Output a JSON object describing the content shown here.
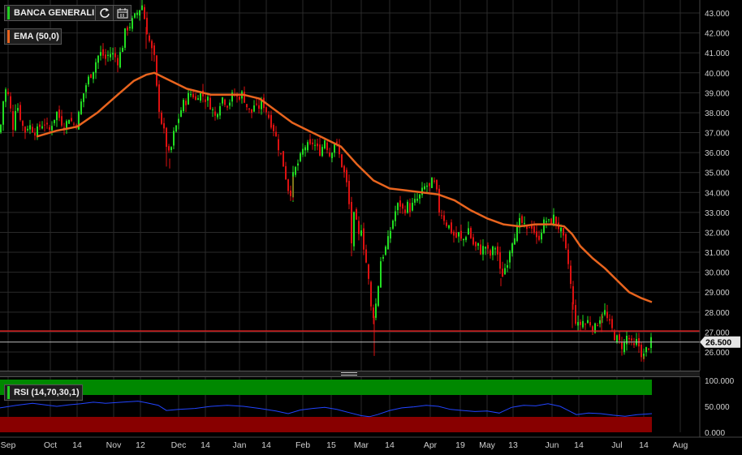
{
  "main_legend": {
    "symbol": "BANCA GENERALI",
    "symbol_color": "#22cc22",
    "refresh_icon": "refresh-icon",
    "calendar_icon": "calendar-icon"
  },
  "ema_legend": {
    "label": "EMA (50,0)",
    "color": "#e8641e"
  },
  "rsi_legend": {
    "label": "RSI (14,70,30,1)",
    "color": "#22cc22"
  },
  "colors": {
    "up": "#22dd22",
    "down": "#dd1111",
    "ema": "#e8641e",
    "support_line": "#dd2222",
    "rsi_line": "#2244ff",
    "rsi_overbought": "#008800",
    "rsi_oversold": "#880000",
    "grid": "#2a2a2a"
  },
  "chart_data": [
    {
      "type": "candlestick",
      "title": "BANCA GENERALI",
      "y_ticks": [
        "43.000",
        "42.000",
        "41.000",
        "40.000",
        "39.000",
        "38.000",
        "37.000",
        "36.000",
        "35.000",
        "34.000",
        "33.000",
        "32.000",
        "31.000",
        "30.000",
        "29.000",
        "28.000",
        "27.000",
        "26.000"
      ],
      "ylim": [
        25.4,
        43.5
      ],
      "x_ticks": [
        "Sep",
        "Oct",
        "14",
        "Nov",
        "12",
        "Dec",
        "14",
        "Jan",
        "14",
        "Feb",
        "15",
        "Mar",
        "14",
        "Apr",
        "19",
        "May",
        "13",
        "Jun",
        "14",
        "Jul",
        "14",
        "Aug"
      ],
      "last_price_label": "26.500",
      "last_price": 26.5,
      "support_level": 27.05,
      "close_path": [
        [
          0,
          37.0
        ],
        [
          4,
          38.6
        ],
        [
          8,
          39.3
        ],
        [
          12,
          38.4
        ],
        [
          16,
          37.3
        ],
        [
          20,
          38.6
        ],
        [
          25,
          37.8
        ],
        [
          30,
          37.0
        ],
        [
          35,
          37.4
        ],
        [
          40,
          37.2
        ],
        [
          45,
          37.0
        ],
        [
          50,
          37.4
        ],
        [
          55,
          37.5
        ],
        [
          60,
          37.0
        ],
        [
          65,
          37.6
        ],
        [
          70,
          38.0
        ],
        [
          75,
          37.6
        ],
        [
          80,
          37.3
        ],
        [
          85,
          37.8
        ],
        [
          90,
          37.4
        ],
        [
          95,
          37.5
        ],
        [
          100,
          38.5
        ],
        [
          105,
          39.3
        ],
        [
          110,
          39.8
        ],
        [
          115,
          40.2
        ],
        [
          120,
          40.8
        ],
        [
          125,
          41.0
        ],
        [
          130,
          40.7
        ],
        [
          135,
          41.0
        ],
        [
          140,
          40.9
        ],
        [
          145,
          40.6
        ],
        [
          150,
          41.2
        ],
        [
          155,
          42.2
        ],
        [
          160,
          42.4
        ],
        [
          165,
          42.7
        ],
        [
          170,
          43.1
        ],
        [
          175,
          43.4
        ],
        [
          180,
          42.3
        ],
        [
          185,
          41.4
        ],
        [
          190,
          40.7
        ],
        [
          193,
          39.2
        ],
        [
          197,
          37.9
        ],
        [
          201,
          37.2
        ],
        [
          205,
          36.4
        ],
        [
          209,
          35.7
        ],
        [
          213,
          36.8
        ],
        [
          217,
          37.3
        ],
        [
          221,
          37.9
        ],
        [
          225,
          38.4
        ],
        [
          229,
          38.6
        ],
        [
          233,
          38.9
        ],
        [
          237,
          39.0
        ],
        [
          241,
          38.6
        ],
        [
          245,
          39.1
        ],
        [
          249,
          38.9
        ],
        [
          253,
          38.7
        ],
        [
          257,
          38.6
        ],
        [
          261,
          38.2
        ],
        [
          265,
          37.8
        ],
        [
          269,
          38.3
        ],
        [
          273,
          38.8
        ],
        [
          277,
          38.6
        ],
        [
          281,
          38.4
        ],
        [
          285,
          38.8
        ],
        [
          289,
          38.9
        ],
        [
          293,
          38.7
        ],
        [
          297,
          39.0
        ],
        [
          301,
          38.7
        ],
        [
          305,
          38.2
        ],
        [
          309,
          37.9
        ],
        [
          313,
          38.4
        ],
        [
          317,
          38.1
        ],
        [
          321,
          38.5
        ],
        [
          325,
          38.4
        ],
        [
          329,
          38.0
        ],
        [
          333,
          37.6
        ],
        [
          337,
          37.2
        ],
        [
          341,
          36.6
        ],
        [
          345,
          36.0
        ],
        [
          349,
          35.4
        ],
        [
          353,
          34.6
        ],
        [
          357,
          33.8
        ],
        [
          361,
          34.8
        ],
        [
          365,
          35.3
        ],
        [
          369,
          35.6
        ],
        [
          373,
          36.1
        ],
        [
          377,
          36.4
        ],
        [
          381,
          36.2
        ],
        [
          385,
          36.5
        ],
        [
          389,
          36.3
        ],
        [
          393,
          36.0
        ],
        [
          397,
          36.3
        ],
        [
          401,
          36.8
        ],
        [
          405,
          35.8
        ],
        [
          409,
          36.2
        ],
        [
          413,
          36.6
        ],
        [
          417,
          36.0
        ],
        [
          421,
          35.4
        ],
        [
          425,
          34.8
        ],
        [
          429,
          34.0
        ],
        [
          433,
          31.5
        ],
        [
          437,
          33.2
        ],
        [
          441,
          31.6
        ],
        [
          445,
          32.3
        ],
        [
          449,
          31.0
        ],
        [
          453,
          30.0
        ],
        [
          457,
          28.2
        ],
        [
          461,
          27.8
        ],
        [
          465,
          29.0
        ],
        [
          469,
          30.6
        ],
        [
          473,
          31.0
        ],
        [
          477,
          31.4
        ],
        [
          481,
          32.1
        ],
        [
          485,
          32.8
        ],
        [
          489,
          33.3
        ],
        [
          493,
          33.4
        ],
        [
          497,
          33.0
        ],
        [
          501,
          33.4
        ],
        [
          505,
          33.2
        ],
        [
          509,
          33.4
        ],
        [
          513,
          33.6
        ],
        [
          517,
          33.8
        ],
        [
          521,
          34.1
        ],
        [
          525,
          34.4
        ],
        [
          529,
          34.2
        ],
        [
          533,
          34.6
        ],
        [
          537,
          34.2
        ],
        [
          541,
          33.1
        ],
        [
          545,
          32.9
        ],
        [
          549,
          32.5
        ],
        [
          553,
          32.3
        ],
        [
          557,
          32.0
        ],
        [
          561,
          31.7
        ],
        [
          565,
          31.9
        ],
        [
          569,
          31.5
        ],
        [
          573,
          31.8
        ],
        [
          577,
          32.2
        ],
        [
          581,
          31.6
        ],
        [
          585,
          31.2
        ],
        [
          589,
          31.3
        ],
        [
          593,
          31.0
        ],
        [
          597,
          31.4
        ],
        [
          601,
          31.0
        ],
        [
          605,
          30.8
        ],
        [
          609,
          31.4
        ],
        [
          613,
          30.9
        ],
        [
          617,
          29.7
        ],
        [
          621,
          30.1
        ],
        [
          625,
          30.6
        ],
        [
          629,
          31.4
        ],
        [
          633,
          31.9
        ],
        [
          637,
          32.1
        ],
        [
          641,
          32.6
        ],
        [
          645,
          32.3
        ],
        [
          649,
          32.0
        ],
        [
          653,
          32.5
        ],
        [
          657,
          32.2
        ],
        [
          661,
          31.6
        ],
        [
          665,
          31.9
        ],
        [
          669,
          32.4
        ],
        [
          673,
          32.6
        ],
        [
          677,
          32.4
        ],
        [
          681,
          32.8
        ],
        [
          685,
          32.5
        ],
        [
          689,
          32.2
        ],
        [
          693,
          31.8
        ],
        [
          697,
          31.0
        ],
        [
          701,
          30.2
        ],
        [
          705,
          28.5
        ],
        [
          709,
          27.6
        ],
        [
          713,
          27.2
        ],
        [
          717,
          27.6
        ],
        [
          721,
          27.4
        ],
        [
          725,
          27.6
        ],
        [
          729,
          27.3
        ],
        [
          733,
          27.2
        ],
        [
          737,
          27.6
        ],
        [
          741,
          27.9
        ],
        [
          745,
          28.0
        ],
        [
          749,
          27.5
        ],
        [
          753,
          27.2
        ],
        [
          757,
          26.8
        ],
        [
          761,
          26.6
        ],
        [
          765,
          26.3
        ],
        [
          769,
          26.4
        ],
        [
          773,
          26.9
        ],
        [
          777,
          26.4
        ],
        [
          781,
          26.2
        ],
        [
          785,
          26.6
        ],
        [
          789,
          26.0
        ],
        [
          793,
          25.8
        ],
        [
          797,
          26.2
        ],
        [
          801,
          26.5
        ],
        [
          803,
          26.5
        ]
      ],
      "spikes": [
        [
          180,
          41.2
        ],
        [
          187,
          40.6
        ],
        [
          205,
          35.3
        ],
        [
          209,
          35.2
        ],
        [
          357,
          33.8
        ],
        [
          361,
          33.6
        ],
        [
          433,
          30.8
        ],
        [
          461,
          25.8
        ],
        [
          617,
          29.3
        ],
        [
          705,
          27.2
        ],
        [
          741,
          27.0
        ],
        [
          793,
          25.5
        ]
      ],
      "ema_path": [
        [
          45,
          36.8
        ],
        [
          70,
          37.1
        ],
        [
          95,
          37.3
        ],
        [
          120,
          38.0
        ],
        [
          145,
          38.9
        ],
        [
          165,
          39.6
        ],
        [
          180,
          39.9
        ],
        [
          190,
          40.0
        ],
        [
          205,
          39.7
        ],
        [
          230,
          39.2
        ],
        [
          260,
          38.9
        ],
        [
          285,
          38.9
        ],
        [
          300,
          38.9
        ],
        [
          320,
          38.7
        ],
        [
          340,
          38.1
        ],
        [
          360,
          37.5
        ],
        [
          380,
          37.1
        ],
        [
          400,
          36.7
        ],
        [
          420,
          36.3
        ],
        [
          440,
          35.4
        ],
        [
          460,
          34.6
        ],
        [
          480,
          34.2
        ],
        [
          500,
          34.1
        ],
        [
          520,
          34.0
        ],
        [
          540,
          33.9
        ],
        [
          560,
          33.6
        ],
        [
          580,
          33.1
        ],
        [
          600,
          32.7
        ],
        [
          620,
          32.4
        ],
        [
          640,
          32.3
        ],
        [
          660,
          32.4
        ],
        [
          680,
          32.4
        ],
        [
          695,
          32.3
        ],
        [
          705,
          31.9
        ],
        [
          715,
          31.3
        ],
        [
          730,
          30.7
        ],
        [
          745,
          30.2
        ],
        [
          760,
          29.6
        ],
        [
          775,
          29.0
        ],
        [
          790,
          28.7
        ],
        [
          803,
          28.5
        ]
      ],
      "ema_color": "#e8641e"
    },
    {
      "type": "line",
      "title": "RSI (14,70,30,1)",
      "y_ticks": [
        "100.000",
        "50.000",
        "0.000"
      ],
      "ylim": [
        0,
        100
      ],
      "overbought": 70,
      "oversold": 30,
      "rsi_path": [
        [
          0,
          47
        ],
        [
          20,
          52
        ],
        [
          40,
          56
        ],
        [
          55,
          53
        ],
        [
          70,
          50
        ],
        [
          85,
          53
        ],
        [
          100,
          55
        ],
        [
          115,
          58
        ],
        [
          130,
          56
        ],
        [
          150,
          58
        ],
        [
          170,
          60
        ],
        [
          180,
          57
        ],
        [
          195,
          52
        ],
        [
          205,
          42
        ],
        [
          220,
          44
        ],
        [
          240,
          46
        ],
        [
          260,
          50
        ],
        [
          280,
          52
        ],
        [
          300,
          50
        ],
        [
          320,
          46
        ],
        [
          340,
          41
        ],
        [
          355,
          36
        ],
        [
          370,
          43
        ],
        [
          385,
          46
        ],
        [
          400,
          48
        ],
        [
          415,
          44
        ],
        [
          430,
          38
        ],
        [
          445,
          32
        ],
        [
          455,
          30
        ],
        [
          465,
          34
        ],
        [
          480,
          42
        ],
        [
          495,
          47
        ],
        [
          510,
          49
        ],
        [
          525,
          52
        ],
        [
          540,
          50
        ],
        [
          555,
          44
        ],
        [
          570,
          42
        ],
        [
          585,
          40
        ],
        [
          600,
          41
        ],
        [
          615,
          37
        ],
        [
          630,
          48
        ],
        [
          645,
          52
        ],
        [
          660,
          51
        ],
        [
          675,
          55
        ],
        [
          690,
          50
        ],
        [
          700,
          42
        ],
        [
          710,
          34
        ],
        [
          725,
          37
        ],
        [
          740,
          36
        ],
        [
          755,
          33
        ],
        [
          770,
          31
        ],
        [
          785,
          34
        ],
        [
          795,
          35
        ],
        [
          803,
          36
        ]
      ]
    }
  ]
}
